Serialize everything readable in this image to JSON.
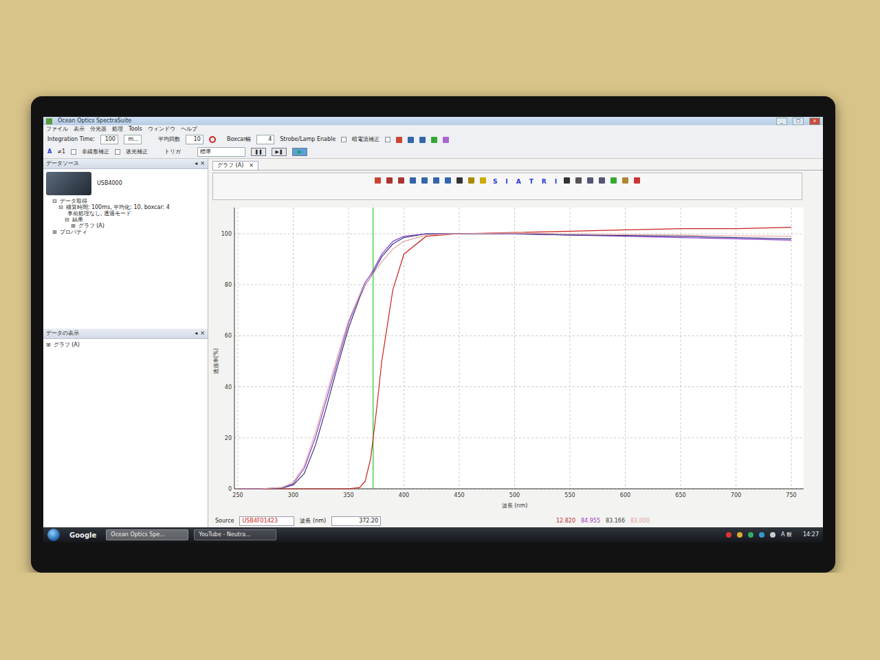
{
  "window": {
    "title": "Ocean Optics SpectraSuite",
    "controls": [
      "_",
      "□",
      "×"
    ]
  },
  "menu": [
    "ファイル",
    "表示",
    "分光器",
    "処理",
    "Tools",
    "ウィンドウ",
    "ヘルプ"
  ],
  "toolbar": {
    "integration_label": "Integration Time:",
    "integration_value": "100",
    "integration_unit": "m...",
    "average_label": "平均回数",
    "average_value": "10",
    "boxcar_label": "Boxcar幅",
    "boxcar_value": "4",
    "strobe_label": "Strobe/Lamp Enable",
    "strobe_checked": false,
    "dark_label": "暗電流補正",
    "dark_checked": false,
    "mode_letter": "A",
    "channel": "≠1",
    "nonlinear_label": "非線形補正",
    "nonlinear_checked": false,
    "stray_label": "迷光補正",
    "stray_checked": false,
    "trigger_label": "トリガ",
    "trigger_value": "標準",
    "buttons": [
      {
        "label": "❚❚",
        "selected": false
      },
      {
        "label": "▶❚",
        "selected": false
      },
      {
        "label": "▶",
        "selected": true
      }
    ]
  },
  "datasource": {
    "title": "データソース",
    "pane_controls": [
      "◂",
      "×"
    ],
    "device": "USB4000",
    "tree": [
      {
        "expander": "⊟",
        "label": "データ取得",
        "depth": 1
      },
      {
        "expander": "⊟",
        "label": "積算時間: 100ms, 平均化: 10, boxcar: 4",
        "depth": 2
      },
      {
        "expander": "",
        "label": "事前処理なし, 透過モード",
        "depth": 3
      },
      {
        "expander": "⊟",
        "label": "結果",
        "depth": 3
      },
      {
        "expander": "⊞",
        "label": "グラフ (A)",
        "depth": 4
      },
      {
        "expander": "⊞",
        "label": "プロパティ",
        "depth": 1
      }
    ]
  },
  "display": {
    "title": "データの表示",
    "pane_controls": [
      "◂",
      "×"
    ],
    "items": [
      {
        "expander": "⊞",
        "label": "グラフ (A)"
      }
    ]
  },
  "graph": {
    "tab": "グラフ (A)",
    "tab_close": "×",
    "letters": [
      "S",
      "I",
      "A",
      "T",
      "R",
      "I"
    ],
    "y_label": "透過率(%)",
    "x_label": "波長 (nm)",
    "y_ticks": [
      "0",
      "20",
      "40",
      "60",
      "80",
      "100"
    ],
    "x_ticks": [
      "250",
      "300",
      "350",
      "400",
      "450",
      "500",
      "550",
      "600",
      "650",
      "700",
      "750"
    ],
    "cursor": 372.2,
    "x_values": [
      250,
      270,
      290,
      300,
      310,
      320,
      330,
      340,
      350,
      360,
      365,
      370,
      375,
      380,
      390,
      400,
      420,
      450,
      500,
      550,
      600,
      650,
      700,
      750
    ],
    "series": [
      {
        "color": "#c8201c",
        "values": [
          0,
          0,
          0,
          0,
          0,
          0,
          0,
          0,
          0,
          0.5,
          3,
          12,
          30,
          50,
          78,
          92,
          99,
          100,
          100.5,
          101,
          101.5,
          102,
          102,
          102.5
        ]
      },
      {
        "color": "#8a3fd0",
        "values": [
          0,
          0,
          0.5,
          2,
          8,
          20,
          35,
          50,
          65,
          76,
          81,
          84,
          88,
          92,
          97,
          99,
          100,
          100,
          100,
          99.5,
          99,
          98.5,
          98,
          97.5
        ]
      },
      {
        "color": "#35357a",
        "values": [
          0,
          0,
          0.3,
          1.5,
          6,
          17,
          32,
          48,
          63,
          75,
          80,
          83,
          87,
          91,
          96,
          98.5,
          100,
          100,
          100,
          99.5,
          99.3,
          99,
          98.5,
          98
        ]
      },
      {
        "color": "#e6a4a4",
        "values": [
          0,
          0,
          0.5,
          2.5,
          9,
          22,
          37,
          52,
          66,
          76,
          80,
          83,
          86,
          89,
          94,
          97,
          99.5,
          100,
          100.3,
          100,
          99.7,
          99.5,
          99.2,
          99
        ]
      }
    ]
  },
  "status": {
    "source_label": "Source",
    "source_value": "USB4F01423",
    "wavelength_label": "波長 (nm)",
    "wavelength_value": "372.20",
    "readings": [
      {
        "text": "12.820",
        "color": "#c0302a"
      },
      {
        "text": "84.955",
        "color": "#9a40c0"
      },
      {
        "text": "83.166",
        "color": "#444444"
      },
      {
        "text": "83.000",
        "color": "#e0a0a0"
      }
    ]
  },
  "taskbar": {
    "items": [
      {
        "label": "Google",
        "kind": "plain",
        "selected": false
      },
      {
        "label": "Ocean Optics Spe...",
        "kind": "task",
        "selected": true
      },
      {
        "label": "YouTube - Neutra...",
        "kind": "task",
        "selected": false
      }
    ],
    "ime": "A 般",
    "time": "14:27"
  }
}
